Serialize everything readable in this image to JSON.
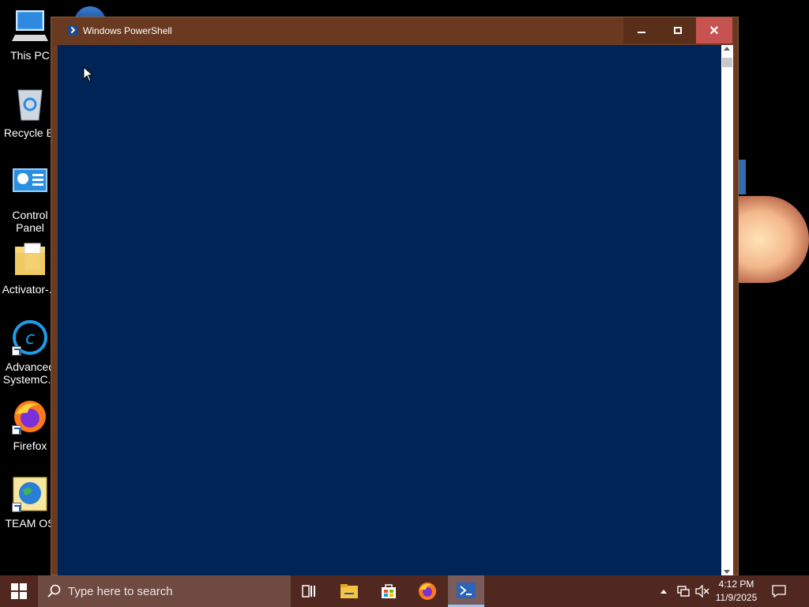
{
  "desktop": {
    "icons": [
      {
        "label": "This PC",
        "name": "this-pc-icon"
      },
      {
        "label": "Recycle Bi",
        "name": "recycle-bin-icon"
      },
      {
        "label": "Control Panel",
        "name": "control-panel-icon"
      },
      {
        "label": "Activator-...",
        "name": "folder-icon"
      },
      {
        "label": "Advanced SystemC...",
        "name": "advanced-systemcare-icon"
      },
      {
        "label": "Firefox",
        "name": "firefox-icon"
      },
      {
        "label": "TEAM OS",
        "name": "team-os-globe-icon"
      }
    ]
  },
  "window": {
    "title": "Windows PowerShell",
    "console_bg": "#012456",
    "titlebar_bg": "#6a3a20",
    "close_hover": "#c65252"
  },
  "taskbar": {
    "search_placeholder": "Type here to search",
    "time": "4:12 PM",
    "date": "11/9/2025",
    "items": [
      "task-view-icon",
      "file-explorer-icon",
      "microsoft-store-icon",
      "firefox-icon",
      "powershell-icon"
    ]
  }
}
